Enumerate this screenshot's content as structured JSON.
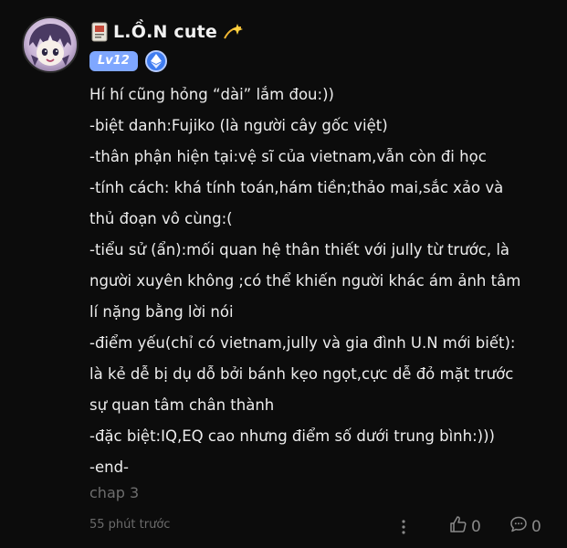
{
  "post": {
    "author": {
      "name": "L.Ồ.N cute",
      "level": "Lv12",
      "name_emoji": "identification-card-icon",
      "trailing_emoji": "dizzy-sparkle-icon",
      "badge_icon": "ethereum-badge-icon"
    },
    "content_lines": [
      "Hí hí cũng hỏng “dài” lắm đou:))",
      "-biệt danh:Fujiko (là người cây gốc việt)",
      "-thân phận hiện tại:vệ sĩ của vietnam,vẫn còn đi học",
      "-tính cách: khá tính toán,hám tiền;thảo mai,sắc xảo và",
      "thủ đoạn vô cùng:(",
      "-tiểu sử (ẩn):mối quan hệ thân thiết với jully từ trước, là",
      "người xuyên không ;có thể khiến người khác ám ảnh tâm",
      "lí nặng bằng lời nói",
      "-điểm yếu(chỉ có vietnam,jully và gia đình U.N mới biết):",
      "là kẻ dễ bị dụ dỗ bởi bánh kẹo ngọt,cực dễ đỏ mặt trước",
      "sự quan tâm chân thành",
      "-đặc biệt:IQ,EQ cao nhưng điểm số dưới trung bình:)))",
      "-end-"
    ],
    "chapter": "chap 3",
    "timestamp": "55 phút trước",
    "likes": "0",
    "comments": "0"
  },
  "colors": {
    "background": "#0c0c0c",
    "text": "#ededed",
    "muted": "#6e6e6e",
    "level_badge": "#7fa7ff",
    "eth_badge": "#3f7cf0"
  }
}
